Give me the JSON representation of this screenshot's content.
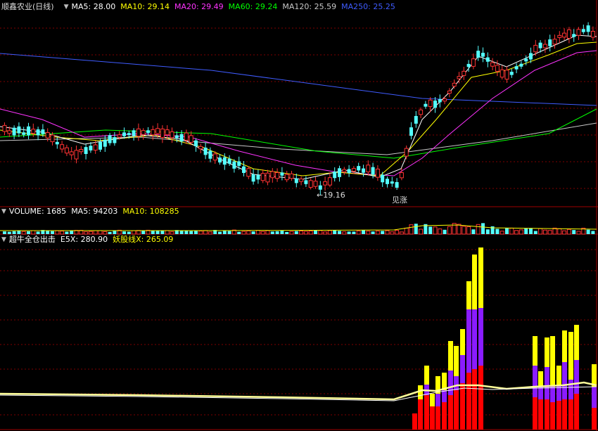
{
  "title": {
    "stock_name": "顺鑫农业",
    "period": "(日线)"
  },
  "ma_legend": [
    {
      "label": "MA5: 28.00",
      "color": "#ffffff"
    },
    {
      "label": "MA10: 29.14",
      "color": "#ffff00"
    },
    {
      "label": "MA20: 29.49",
      "color": "#ff33ff"
    },
    {
      "label": "MA60: 29.24",
      "color": "#00ff00"
    },
    {
      "label": "MA120: 25.59",
      "color": "#c8c8c8"
    },
    {
      "label": "MA250: 25.25",
      "color": "#3f5cff"
    }
  ],
  "volume_legend": [
    {
      "label": "VOLUME: 1685",
      "color": "#ffffff"
    },
    {
      "label": "MA5: 94203",
      "color": "#ffffff"
    },
    {
      "label": "MA10: 108285",
      "color": "#ffff00"
    }
  ],
  "indicator_legend": [
    {
      "label": "超牛全仓出击",
      "color": "#ffffff"
    },
    {
      "label": "E5X: 280.90",
      "color": "#ffffff"
    },
    {
      "label": "妖股线X: 265.09",
      "color": "#ffff00"
    }
  ],
  "annotations": {
    "low_price": "←19.16",
    "buy_signal": "见涨"
  },
  "colors": {
    "up": "#ff3333",
    "down": "#54ffff",
    "grid": "#800000",
    "yellow": "#ffff00",
    "purple": "#8a1cff",
    "red": "#ff0000",
    "line": "#ffff99"
  },
  "icons": {
    "control": "triangle-down-icon"
  }
}
